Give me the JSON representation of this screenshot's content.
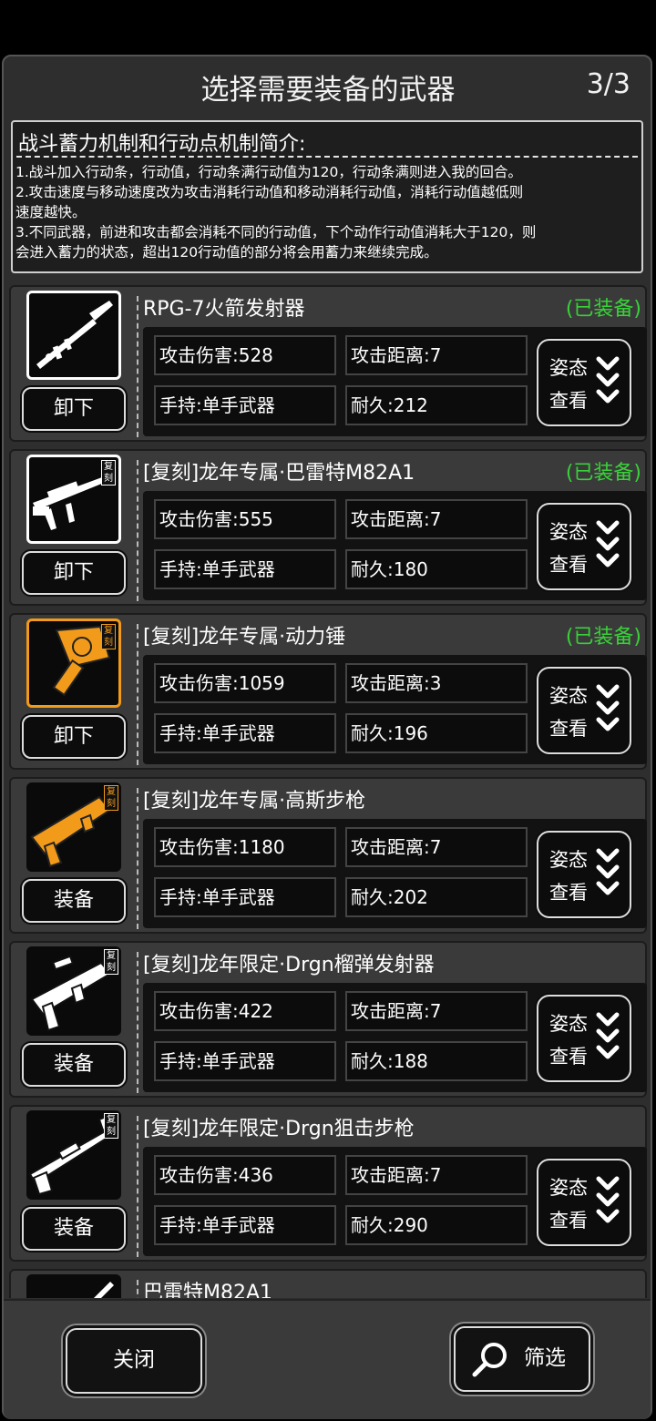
{
  "dialog": {
    "title": "选择需要装备的武器",
    "page": "3/3"
  },
  "intro": {
    "heading": "战斗蓄力机制和行动点机制简介:",
    "lines": [
      "1.战斗加入行动条，行动值，行动条满行动值为120，行动条满则进入我的回合。",
      "2.攻击速度与移动速度改为攻击消耗行动值和移动消耗行动值，消耗行动值越低则",
      "速度越快。",
      "3.不同武器，前进和攻击都会消耗不同的行动值，下个动作行动值消耗大于120，则",
      "会进入蓄力的状态，超出120行动值的部分将会用蓄力来继续完成。"
    ]
  },
  "pose_button": {
    "line1": "姿态",
    "line2": "查看"
  },
  "weapons": [
    {
      "name": "RPG-7火箭发射器",
      "equipped_label": "(已装备)",
      "action": "卸下",
      "damage": "攻击伤害:528",
      "range": "攻击距离:7",
      "hold": "手持:单手武器",
      "durability": "耐久:212",
      "badge": "",
      "icon": "rpg-icon"
    },
    {
      "name": "[复刻]龙年专属·巴雷特M82A1",
      "equipped_label": "(已装备)",
      "action": "卸下",
      "damage": "攻击伤害:555",
      "range": "攻击距离:7",
      "hold": "手持:单手武器",
      "durability": "耐久:180",
      "badge": "复刻",
      "icon": "sniper-icon"
    },
    {
      "name": "[复刻]龙年专属·动力锤",
      "equipped_label": "(已装备)",
      "action": "卸下",
      "damage": "攻击伤害:1059",
      "range": "攻击距离:3",
      "hold": "手持:单手武器",
      "durability": "耐久:196",
      "badge": "复刻",
      "icon": "hammer-icon"
    },
    {
      "name": "[复刻]龙年专属·高斯步枪",
      "equipped_label": "",
      "action": "装备",
      "damage": "攻击伤害:1180",
      "range": "攻击距离:7",
      "hold": "手持:单手武器",
      "durability": "耐久:202",
      "badge": "复刻",
      "icon": "gauss-rifle-icon"
    },
    {
      "name": "[复刻]龙年限定·Drgn榴弹发射器",
      "equipped_label": "",
      "action": "装备",
      "damage": "攻击伤害:422",
      "range": "攻击距离:7",
      "hold": "手持:单手武器",
      "durability": "耐久:188",
      "badge": "复刻",
      "icon": "grenade-launcher-icon"
    },
    {
      "name": "[复刻]龙年限定·Drgn狙击步枪",
      "equipped_label": "",
      "action": "装备",
      "damage": "攻击伤害:436",
      "range": "攻击距离:7",
      "hold": "手持:单手武器",
      "durability": "耐久:290",
      "badge": "复刻",
      "icon": "dragon-sniper-icon"
    },
    {
      "name": "巴雷特M82A1"
    }
  ],
  "footer": {
    "close_label": "关闭",
    "filter_label": "筛选"
  },
  "colors": {
    "equipped": "#3ad13a",
    "gold": "#f29a1a"
  }
}
